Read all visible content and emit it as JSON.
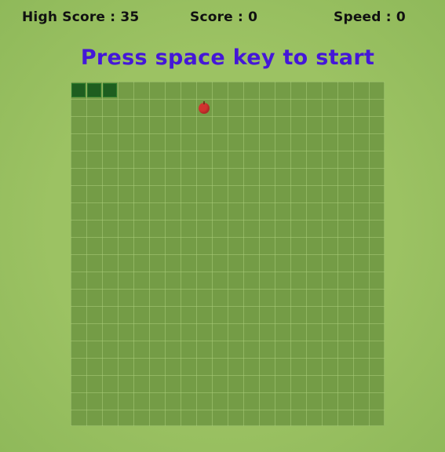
{
  "hud": {
    "high_score_text": "High Score : 35",
    "score_text": "Score : 0",
    "speed_text": "Speed : 0"
  },
  "message": "Press space key to start",
  "board": {
    "columns": 20,
    "rows": 20,
    "snake": [
      {
        "col": 0,
        "row": 0
      },
      {
        "col": 1,
        "row": 0
      },
      {
        "col": 2,
        "row": 0
      }
    ],
    "apple": {
      "col": 8,
      "row": 1
    }
  },
  "colors": {
    "background": "#9cc263",
    "board": "#749c46",
    "snake": "#1e5e1f",
    "apple": "#d1322f",
    "message": "#4417d8"
  },
  "icons": {
    "apple": "apple-icon"
  }
}
